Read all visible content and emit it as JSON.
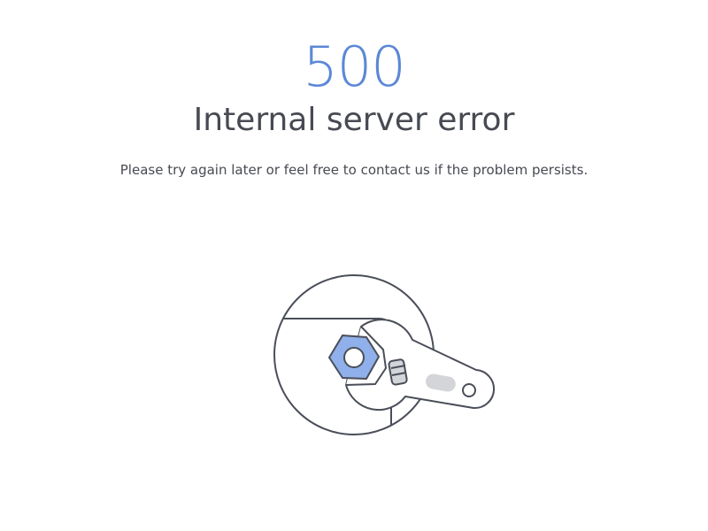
{
  "error": {
    "code": "500",
    "title": "Internal server error",
    "message": "Please try again later or feel free to contact us if the problem persists."
  },
  "illustration": {
    "icon": "wrench-and-nut-icon"
  },
  "colors": {
    "accent": "#5b88d6",
    "text": "#474a52",
    "stroke": "#4a4e58",
    "nut_fill": "#8fb0ea",
    "slot_fill": "#d3d5d9",
    "background": "#ffffff"
  }
}
